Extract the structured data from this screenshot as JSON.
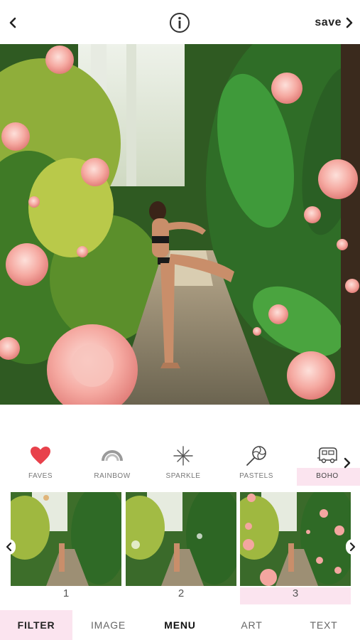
{
  "topbar": {
    "back_icon": "chevron-left-icon",
    "info_icon": "info-icon",
    "save_label": "save",
    "save_icon": "chevron-right-icon"
  },
  "photo": {
    "description_icon": "edited-photo"
  },
  "categories": [
    {
      "label": "FAVES",
      "icon": "heart-icon",
      "color": "#e8414b",
      "active": false
    },
    {
      "label": "RAINBOW",
      "icon": "rainbow-icon",
      "active": false
    },
    {
      "label": "SPARKLE",
      "icon": "sparkle-icon",
      "active": false
    },
    {
      "label": "PASTELS",
      "icon": "lollipop-icon",
      "active": false
    },
    {
      "label": "BOHO",
      "icon": "camper-van-icon",
      "active": true
    }
  ],
  "filters": [
    {
      "number": "1",
      "active": false
    },
    {
      "number": "2",
      "active": false
    },
    {
      "number": "3",
      "active": true
    }
  ],
  "tabs": [
    {
      "label": "FILTER",
      "active": true
    },
    {
      "label": "IMAGE",
      "active": false
    },
    {
      "label": "MENU",
      "active": false
    },
    {
      "label": "ART",
      "active": false
    },
    {
      "label": "TEXT",
      "active": false
    }
  ],
  "colors": {
    "highlight": "#fbe4ef",
    "heart": "#e8414b",
    "rose": "#f4a6a0"
  }
}
